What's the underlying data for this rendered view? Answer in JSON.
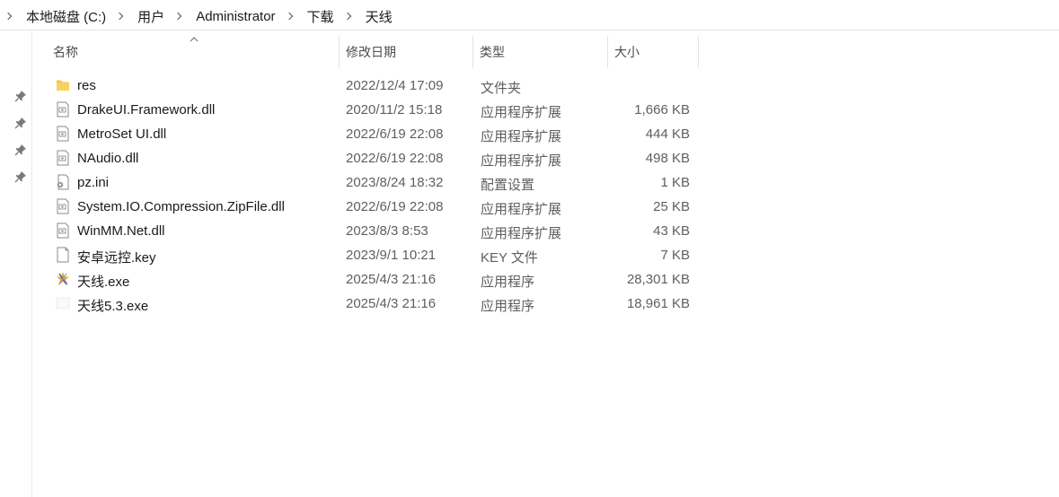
{
  "breadcrumb": {
    "items": [
      "本地磁盘 (C:)",
      "用户",
      "Administrator",
      "下载",
      "天线"
    ]
  },
  "columns": {
    "name": "名称",
    "date": "修改日期",
    "type": "类型",
    "size": "大小"
  },
  "files": [
    {
      "name": "res",
      "date": "2022/12/4 17:09",
      "type": "文件夹",
      "size": "",
      "icon": "folder-icon"
    },
    {
      "name": "DrakeUI.Framework.dll",
      "date": "2020/11/2 15:18",
      "type": "应用程序扩展",
      "size": "1,666 KB",
      "icon": "dll-file-icon"
    },
    {
      "name": "MetroSet UI.dll",
      "date": "2022/6/19 22:08",
      "type": "应用程序扩展",
      "size": "444 KB",
      "icon": "dll-file-icon"
    },
    {
      "name": "NAudio.dll",
      "date": "2022/6/19 22:08",
      "type": "应用程序扩展",
      "size": "498 KB",
      "icon": "dll-file-icon"
    },
    {
      "name": "pz.ini",
      "date": "2023/8/24 18:32",
      "type": "配置设置",
      "size": "1 KB",
      "icon": "ini-file-icon"
    },
    {
      "name": "System.IO.Compression.ZipFile.dll",
      "date": "2022/6/19 22:08",
      "type": "应用程序扩展",
      "size": "25 KB",
      "icon": "dll-file-icon"
    },
    {
      "name": "WinMM.Net.dll",
      "date": "2023/8/3 8:53",
      "type": "应用程序扩展",
      "size": "43 KB",
      "icon": "dll-file-icon"
    },
    {
      "name": "安卓远控.key",
      "date": "2023/9/1 10:21",
      "type": "KEY 文件",
      "size": "7 KB",
      "icon": "blank-file-icon"
    },
    {
      "name": "天线.exe",
      "date": "2025/4/3 21:16",
      "type": "应用程序",
      "size": "28,301 KB",
      "icon": "exe-app-icon"
    },
    {
      "name": "天线5.3.exe",
      "date": "2025/4/3 21:16",
      "type": "应用程序",
      "size": "18,961 KB",
      "icon": "exe-blank-icon"
    }
  ],
  "quick_access_pins": [
    "pin-icon",
    "pin-icon",
    "pin-icon",
    "pin-icon"
  ]
}
